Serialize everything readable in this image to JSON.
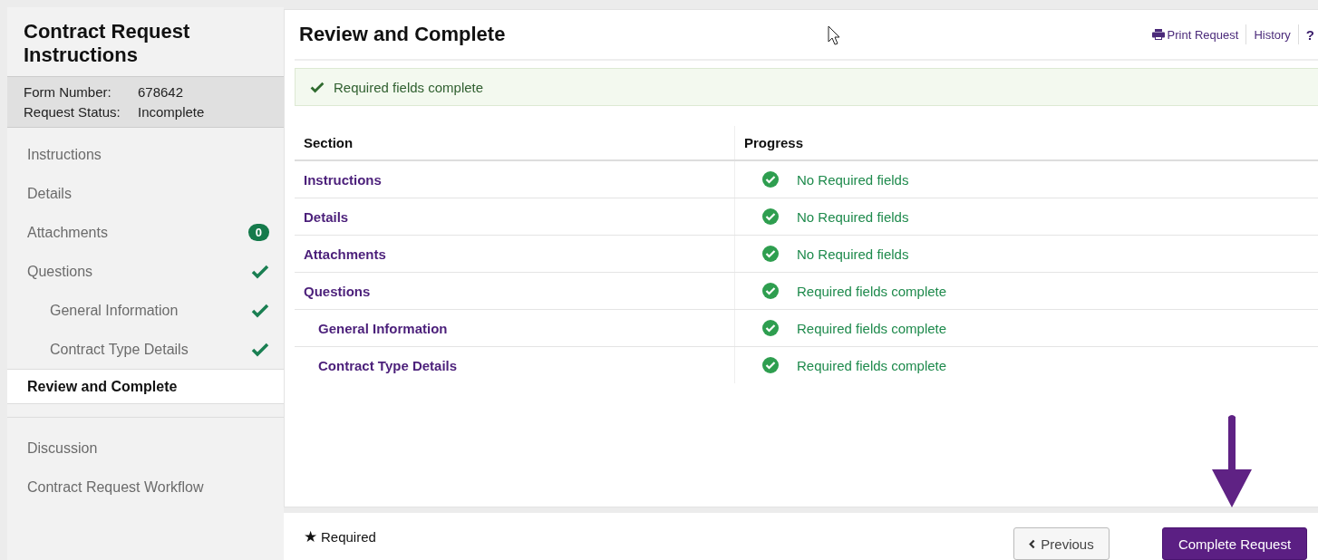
{
  "sidebar": {
    "title": "Contract Request Instructions",
    "info": [
      {
        "label": "Form Number:",
        "value": "678642"
      },
      {
        "label": "Request Status:",
        "value": "Incomplete"
      }
    ],
    "nav": [
      {
        "label": "Instructions",
        "selected": false,
        "complete": false
      },
      {
        "label": "Details",
        "selected": false,
        "complete": false
      },
      {
        "label": "Attachments",
        "selected": false,
        "badge": "0"
      },
      {
        "label": "Questions",
        "selected": false,
        "complete": true,
        "children": [
          {
            "label": "General Information",
            "selected": false,
            "complete": true
          },
          {
            "label": "Contract Type Details",
            "selected": false,
            "complete": true
          }
        ]
      },
      {
        "label": "Review and Complete",
        "selected": true,
        "complete": false
      }
    ],
    "secondary_nav": [
      {
        "label": "Discussion",
        "selected": false
      },
      {
        "label": "Contract Request Workflow",
        "selected": false
      }
    ]
  },
  "header": {
    "title": "Review and Complete",
    "links": [
      {
        "label": "Print Request",
        "kind": "print"
      },
      {
        "label": "History",
        "kind": "text"
      },
      {
        "label": "?",
        "kind": "help"
      }
    ]
  },
  "alert": {
    "text": "Required fields complete"
  },
  "table": {
    "columns": [
      "Section",
      "Progress"
    ],
    "rows": [
      {
        "section": "Instructions",
        "status": "No Required fields",
        "complete": true
      },
      {
        "section": "Details",
        "status": "No Required fields",
        "complete": true
      },
      {
        "section": "Attachments",
        "status": "No Required fields",
        "complete": true
      },
      {
        "section": "Questions",
        "status": "Required fields complete",
        "complete": true,
        "children": [
          {
            "section": "General Information",
            "status": "Required fields complete",
            "complete": true
          },
          {
            "section": "Contract Type Details",
            "status": "Required fields complete",
            "complete": true
          }
        ]
      }
    ]
  },
  "footer": {
    "star": "★",
    "required_note": "Required",
    "previous": "Previous",
    "complete": "Complete Request"
  }
}
